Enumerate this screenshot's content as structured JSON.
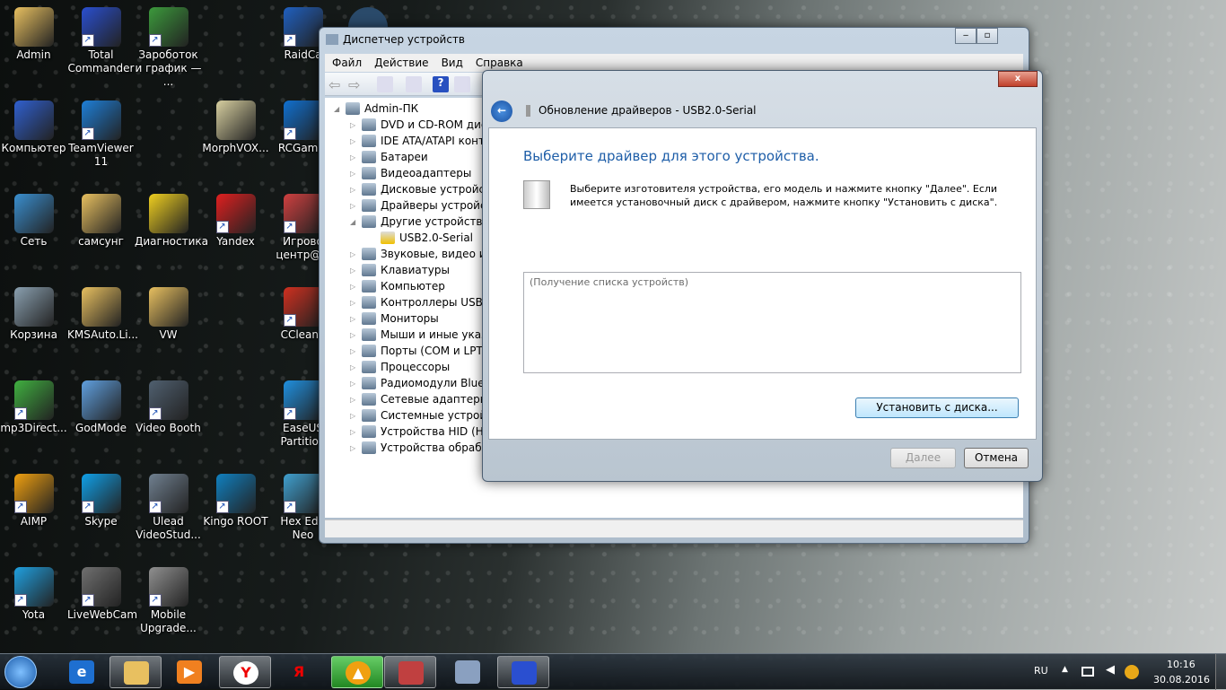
{
  "desktop": {
    "icons": [
      {
        "label": "Admin",
        "color": "#e8c060",
        "col": 0,
        "row": 0
      },
      {
        "label": "Total Commander",
        "color": "#2a4fd0",
        "col": 1,
        "row": 0,
        "shortcut": true
      },
      {
        "label": "Зароботок и график — ...",
        "color": "#3c9a3c",
        "col": 2,
        "row": 0,
        "shortcut": true
      },
      {
        "label": "RaidCa",
        "color": "#2060c0",
        "col": 4,
        "row": 0,
        "shortcut": true
      },
      {
        "label": "Компьютер",
        "color": "#3060d0",
        "col": 0,
        "row": 1
      },
      {
        "label": "TeamViewer 11",
        "color": "#1e7fd8",
        "col": 1,
        "row": 1,
        "shortcut": true
      },
      {
        "label": "MorphVOX...",
        "color": "#d8d0a0",
        "col": 3,
        "row": 1
      },
      {
        "label": "RCGamel",
        "color": "#1070d0",
        "col": 4,
        "row": 1,
        "shortcut": true
      },
      {
        "label": "Сеть",
        "color": "#3a8fd0",
        "col": 0,
        "row": 2
      },
      {
        "label": "самсунг",
        "color": "#e8c060",
        "col": 1,
        "row": 2
      },
      {
        "label": "Диагностика",
        "color": "#f0d020",
        "col": 2,
        "row": 2
      },
      {
        "label": "Yandex",
        "color": "#e02020",
        "col": 3,
        "row": 2,
        "shortcut": true
      },
      {
        "label": "Игрово центр@M",
        "color": "#d04040",
        "col": 4,
        "row": 2,
        "shortcut": true
      },
      {
        "label": "Корзина",
        "color": "#8aa0b0",
        "col": 0,
        "row": 3
      },
      {
        "label": "KMSAuto.Li...",
        "color": "#e8c060",
        "col": 1,
        "row": 3
      },
      {
        "label": "VW",
        "color": "#e8c060",
        "col": 2,
        "row": 3
      },
      {
        "label": "CCleane",
        "color": "#d03020",
        "col": 4,
        "row": 3,
        "shortcut": true
      },
      {
        "label": "mp3Direct...",
        "color": "#40b040",
        "col": 0,
        "row": 4,
        "shortcut": true
      },
      {
        "label": "GodMode",
        "color": "#60a0e0",
        "col": 1,
        "row": 4
      },
      {
        "label": "Video Booth",
        "color": "#506070",
        "col": 2,
        "row": 4,
        "shortcut": true
      },
      {
        "label": "EaseUS Partition",
        "color": "#2090e0",
        "col": 4,
        "row": 4,
        "shortcut": true
      },
      {
        "label": "AIMP",
        "color": "#f0a010",
        "col": 0,
        "row": 5,
        "shortcut": true
      },
      {
        "label": "Skype",
        "color": "#10a0e8",
        "col": 1,
        "row": 5,
        "shortcut": true
      },
      {
        "label": "Ulead VideoStud...",
        "color": "#708090",
        "col": 2,
        "row": 5,
        "shortcut": true
      },
      {
        "label": "Kingo ROOT",
        "color": "#1080c0",
        "col": 3,
        "row": 5,
        "shortcut": true
      },
      {
        "label": "Hex Edit Neo",
        "color": "#40a0d0",
        "col": 4,
        "row": 5,
        "shortcut": true
      },
      {
        "label": "Yota",
        "color": "#20a0e0",
        "col": 0,
        "row": 6,
        "shortcut": true
      },
      {
        "label": "LiveWebCam",
        "color": "#707070",
        "col": 1,
        "row": 6,
        "shortcut": true
      },
      {
        "label": "Mobile Upgrade...",
        "color": "#909090",
        "col": 2,
        "row": 6,
        "shortcut": true
      }
    ]
  },
  "device_manager": {
    "title": "Диспетчер устройств",
    "menu": [
      "Файл",
      "Действие",
      "Вид",
      "Справка"
    ],
    "root": "Admin-ПК",
    "nodes": [
      {
        "label": "DVD и CD-ROM дисководы",
        "expanded": false
      },
      {
        "label": "IDE ATA/ATAPI контроллеры",
        "expanded": false
      },
      {
        "label": "Батареи",
        "expanded": false
      },
      {
        "label": "Видеоадаптеры",
        "expanded": false
      },
      {
        "label": "Дисковые устройства",
        "expanded": false
      },
      {
        "label": "Драйверы устройств",
        "expanded": false
      },
      {
        "label": "Другие устройства",
        "expanded": true
      },
      {
        "label": "USB2.0-Serial",
        "child": true,
        "warning": true
      },
      {
        "label": "Звуковые, видео и игровые",
        "expanded": false
      },
      {
        "label": "Клавиатуры",
        "expanded": false
      },
      {
        "label": "Компьютер",
        "expanded": false
      },
      {
        "label": "Контроллеры USB",
        "expanded": false
      },
      {
        "label": "Мониторы",
        "expanded": false
      },
      {
        "label": "Мыши и иные указывающие",
        "expanded": false
      },
      {
        "label": "Порты (COM и LPT)",
        "expanded": false
      },
      {
        "label": "Процессоры",
        "expanded": false
      },
      {
        "label": "Радиомодули Bluetooth",
        "expanded": false
      },
      {
        "label": "Сетевые адаптеры",
        "expanded": false
      },
      {
        "label": "Системные устройства",
        "expanded": false
      },
      {
        "label": "Устройства HID (Human",
        "expanded": false
      },
      {
        "label": "Устройства обработки",
        "expanded": false
      }
    ]
  },
  "dialog": {
    "title": "Обновление драйверов - USB2.0-Serial",
    "heading": "Выберите драйвер для этого устройства.",
    "description": "Выберите изготовителя устройства, его модель и нажмите кнопку \"Далее\". Если имеется установочный диск с  драйвером, нажмите кнопку \"Установить с диска\".",
    "list_placeholder": "(Получение списка устройств)",
    "have_disk": "Установить с диска...",
    "next": "Далее",
    "cancel": "Отмена",
    "close": "x",
    "accent": "#1e5ea8"
  },
  "taskbar": {
    "language": "RU",
    "time": "10:16",
    "date": "30.08.2016"
  }
}
